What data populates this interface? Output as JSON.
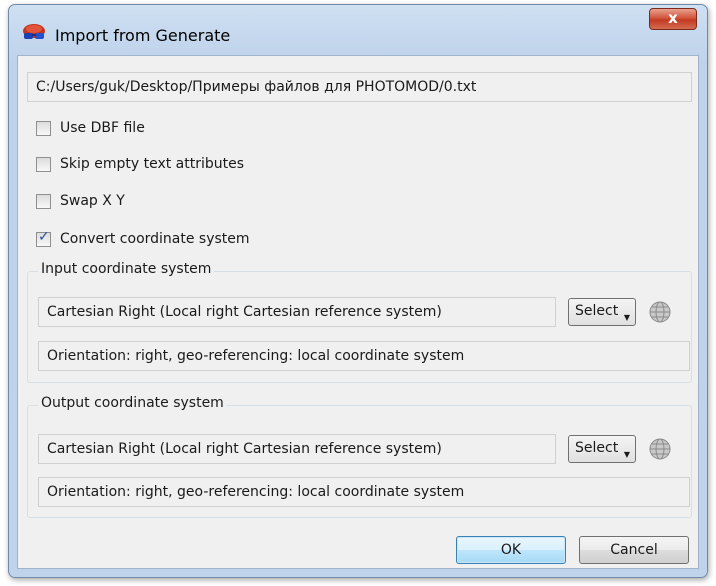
{
  "window": {
    "title": "Import from Generate",
    "close_label": "x"
  },
  "file_path": "C:/Users/guk/Desktop/Примеры файлов для PHOTOMOD/0.txt",
  "options": [
    {
      "label": "Use DBF file",
      "checked": false
    },
    {
      "label": "Skip empty text attributes",
      "checked": false
    },
    {
      "label": "Swap X Y",
      "checked": false
    },
    {
      "label": "Convert coordinate system",
      "checked": true
    }
  ],
  "input_cs": {
    "legend": "Input coordinate system",
    "value": "Cartesian Right (Local right Cartesian reference system)",
    "info": "Orientation: right, geo-referencing: local coordinate system",
    "select_label": "Select"
  },
  "output_cs": {
    "legend": "Output coordinate system",
    "value": "Cartesian Right (Local right Cartesian reference system)",
    "info": "Orientation: right, geo-referencing: local coordinate system",
    "select_label": "Select"
  },
  "buttons": {
    "ok": "OK",
    "cancel": "Cancel"
  },
  "icons": {
    "app": "photomod-3d-glasses-icon",
    "globe": "globe-icon",
    "close": "close-icon"
  }
}
